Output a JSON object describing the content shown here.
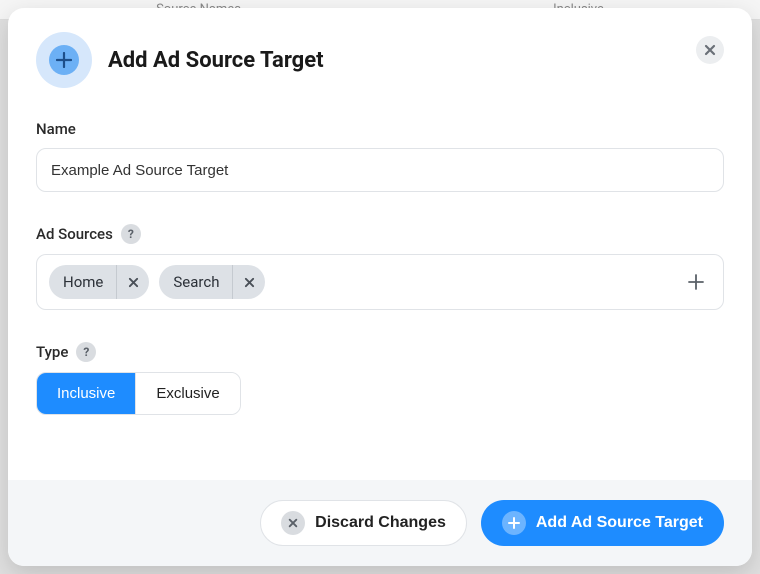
{
  "backdrop": {
    "col_label": "Source Names",
    "col_tag": "Inclusive"
  },
  "dialog": {
    "title": "Add Ad Source Target",
    "name": {
      "label": "Name",
      "value": "Example Ad Source Target"
    },
    "ad_sources": {
      "label": "Ad Sources",
      "chips": [
        {
          "label": "Home"
        },
        {
          "label": "Search"
        }
      ]
    },
    "type": {
      "label": "Type",
      "options": [
        "Inclusive",
        "Exclusive"
      ],
      "selected": "Inclusive"
    },
    "footer": {
      "discard": "Discard Changes",
      "submit": "Add Ad Source Target"
    }
  }
}
